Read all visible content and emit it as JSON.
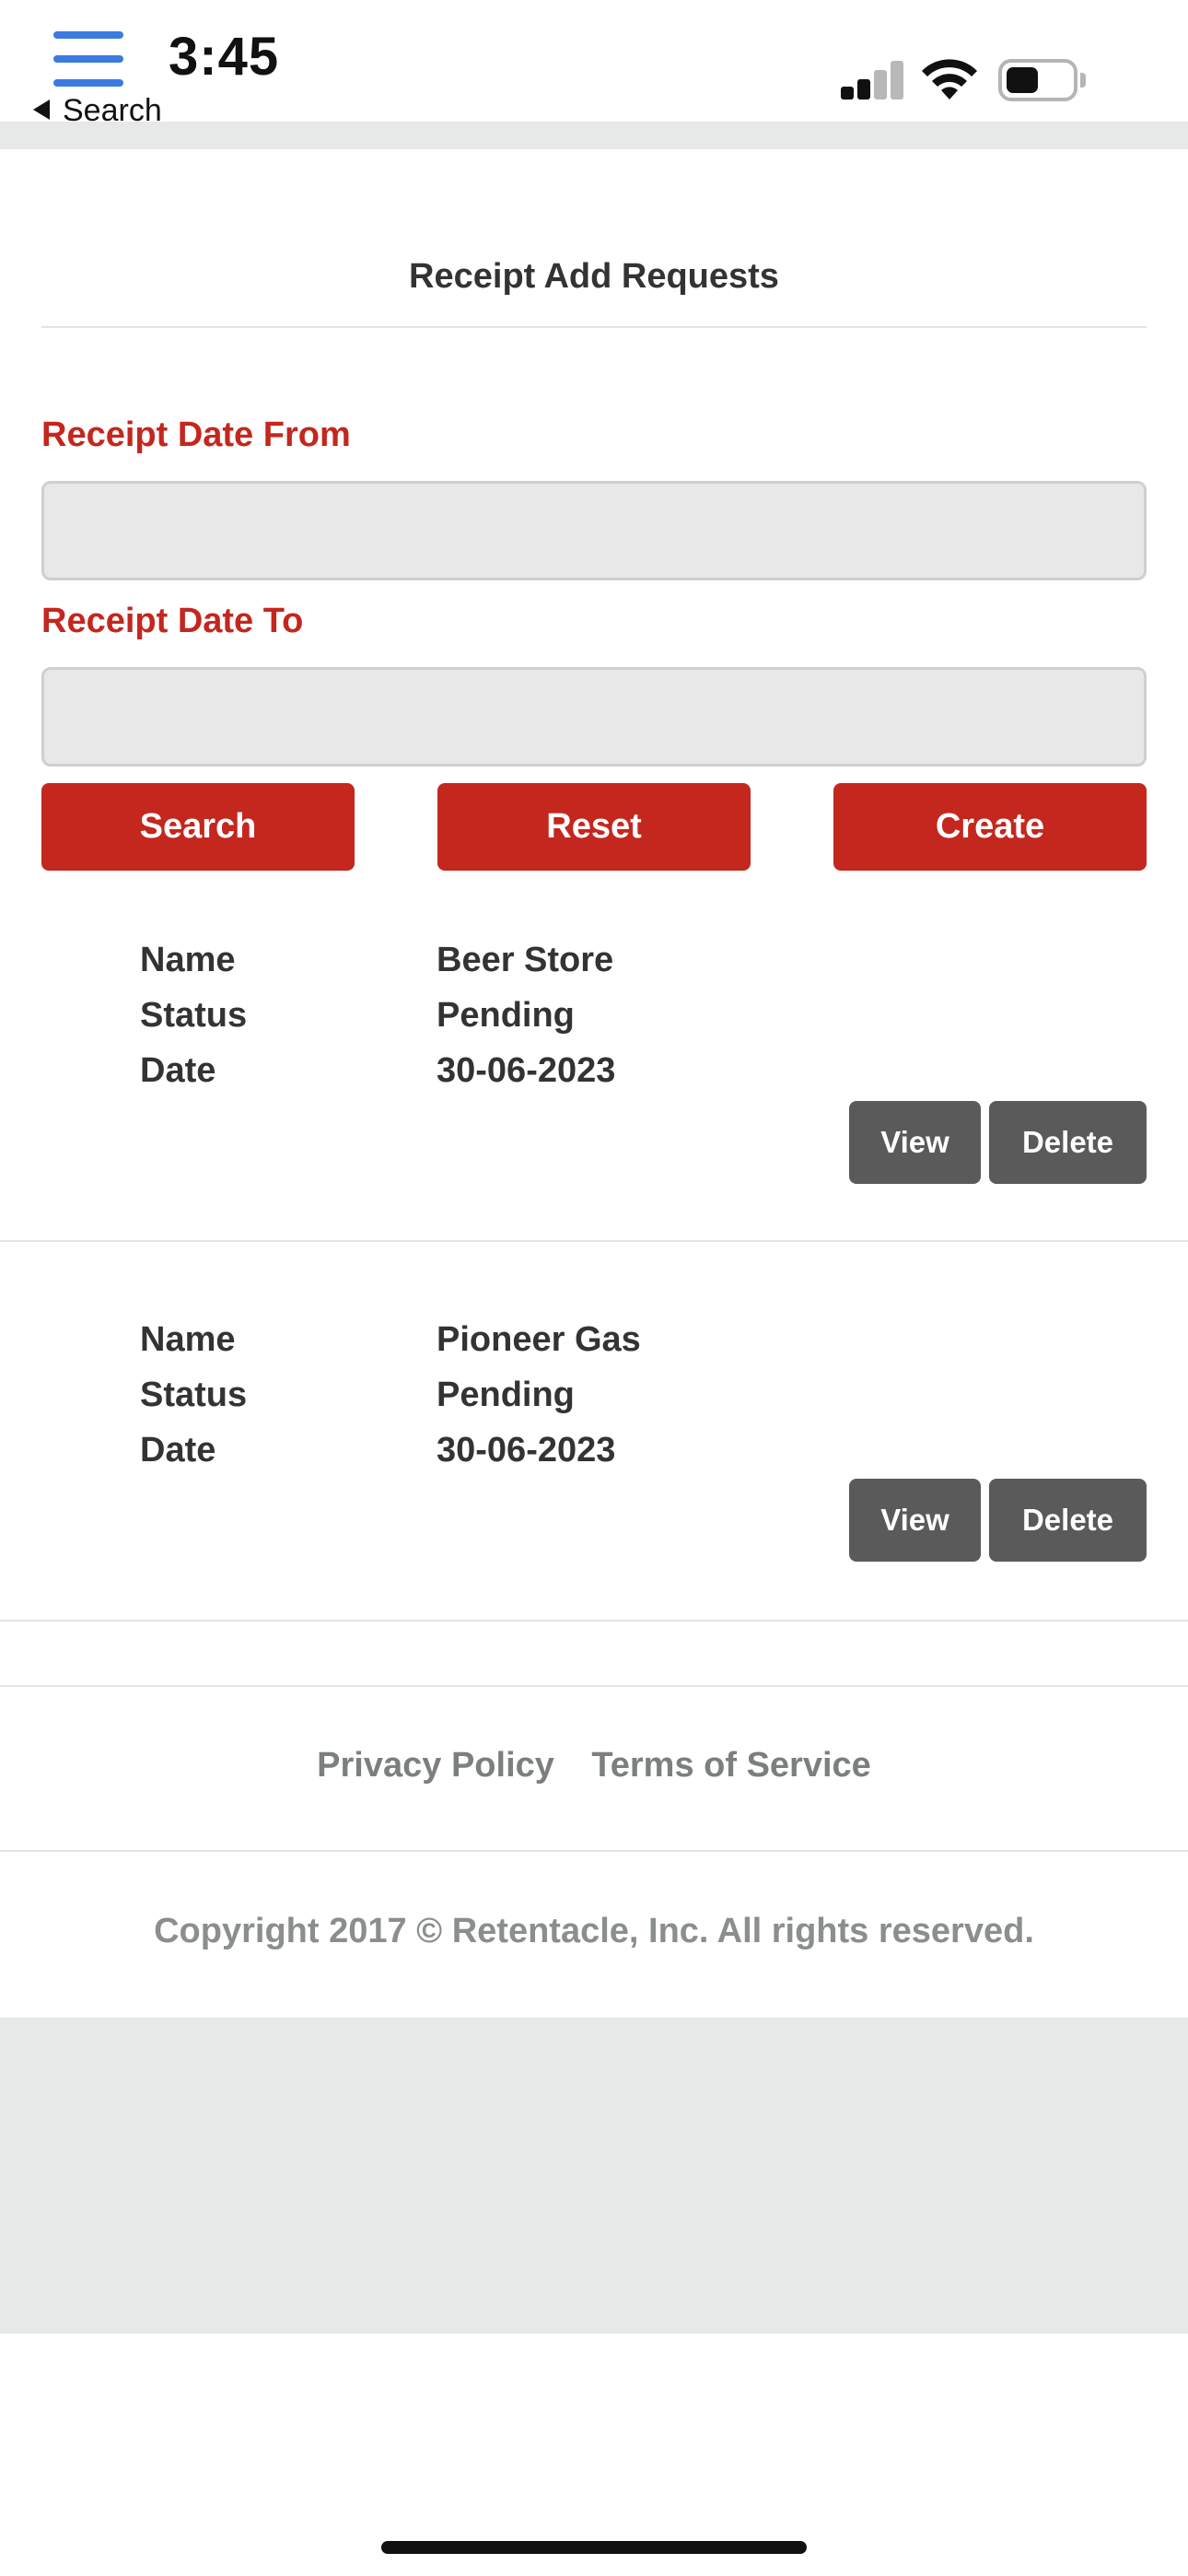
{
  "status_bar": {
    "time": "3:45",
    "back_label": "Search"
  },
  "page": {
    "title": "Receipt Add Requests"
  },
  "filters": {
    "date_from_label": "Receipt Date From",
    "date_from_value": "",
    "date_to_label": "Receipt Date To",
    "date_to_value": ""
  },
  "actions": {
    "search_label": "Search",
    "reset_label": "Reset",
    "create_label": "Create"
  },
  "receipts": [
    {
      "name_key": "Name",
      "name": "Beer Store",
      "status_key": "Status",
      "status": "Pending",
      "date_key": "Date",
      "date": "30-06-2023",
      "view_label": "View",
      "delete_label": "Delete"
    },
    {
      "name_key": "Name",
      "name": "Pioneer Gas",
      "status_key": "Status",
      "status": "Pending",
      "date_key": "Date",
      "date": "30-06-2023",
      "view_label": "View",
      "delete_label": "Delete"
    }
  ],
  "footer": {
    "privacy_label": "Privacy Policy",
    "terms_label": "Terms of Service",
    "copyright": "Copyright 2017 © Retentacle, Inc. All rights reserved."
  },
  "icons": {
    "menu": "hamburger-menu-icon",
    "back": "back-triangle-icon",
    "signal": "cellular-signal-icon",
    "wifi": "wifi-icon",
    "battery": "battery-icon"
  },
  "colors": {
    "accent_red": "#c3271e",
    "button_gray": "#5a5a5a",
    "menu_blue": "#3b7be0",
    "footer_text": "#7b7f80"
  },
  "battery_level": 0.5,
  "signal_bars_active": 2
}
